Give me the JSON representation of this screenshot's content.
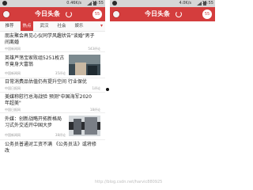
{
  "left_phone": {
    "status": {
      "network": "0.46K/s",
      "time": "15:55"
    },
    "app": {
      "title": "今日头条",
      "badge": "55"
    },
    "tabs": [
      "推荐",
      "热点",
      "武汉",
      "社会",
      "娱乐"
    ],
    "active_tab": 1,
    "feed": [
      {
        "title_1": "朋友聚会再见心仪同学风趣状告\"谈婚\"男子",
        "title_2": "间离婚",
        "meta": "中国新闻网",
        "count": "543评论"
      },
      {
        "title_1": "英雄芦荡宝家败组5251枚古",
        "title_2": "币竟身大富翁",
        "meta": "中国新闻网",
        "count": "35评论",
        "thumb": true
      },
      {
        "title_1": "日常消费品估值仍有提升空间 行业保优",
        "title_2": "",
        "meta": "中国日报网",
        "count": "1评论"
      },
      {
        "title_1": "美媒称慰行总海战验 预测\"中国海军2020",
        "title_2": "年超美\"",
        "meta": "中国日报网",
        "count": "18评论"
      },
      {
        "title_1": "外媒：创新战略开拓新格局",
        "title_2": "习式外交适开中国大步",
        "meta": "中国新闻网",
        "count": "38评论",
        "thumb": true
      },
      {
        "title_1": "公务员普通对工资不满 《公务员法》或将修",
        "title_2": "改",
        "meta": "",
        "count": ""
      }
    ]
  },
  "right_phone": {
    "status": {
      "network": "4.0K/s",
      "time": "15:55"
    },
    "app": {
      "title": "今日头条",
      "badge": "55"
    }
  },
  "watermark": "http://blog.csdn.net/harvic880925"
}
